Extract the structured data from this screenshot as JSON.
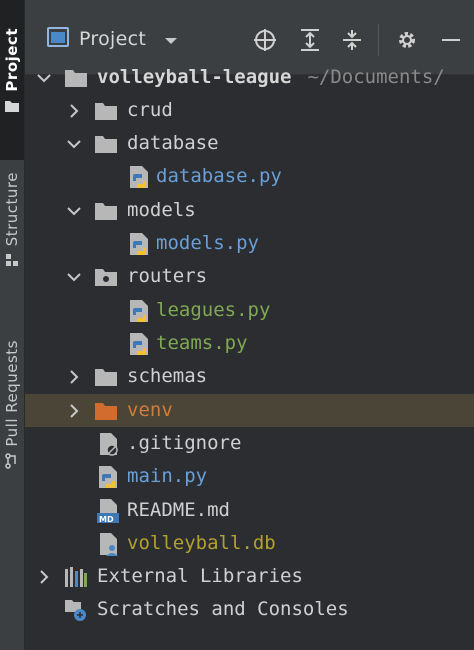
{
  "sidebar": {
    "tabs": [
      {
        "label": "Project",
        "active": true
      },
      {
        "label": "Structure",
        "active": false
      },
      {
        "label": "Pull Requests",
        "active": false
      }
    ]
  },
  "header": {
    "view_label": "Project",
    "buttons": [
      "locate-icon",
      "expand-all-icon",
      "collapse-all-icon",
      "gear-icon",
      "minimize-icon"
    ]
  },
  "tree": {
    "root": {
      "name": "volleyball-league",
      "path": "~/Documents/"
    },
    "items": [
      {
        "name": "crud",
        "type": "folder",
        "expanded": false
      },
      {
        "name": "database",
        "type": "folder",
        "expanded": true
      },
      {
        "name": "database.py",
        "type": "python"
      },
      {
        "name": "models",
        "type": "folder",
        "expanded": true
      },
      {
        "name": "models.py",
        "type": "python"
      },
      {
        "name": "routers",
        "type": "folder",
        "expanded": true
      },
      {
        "name": "leagues.py",
        "type": "python"
      },
      {
        "name": "teams.py",
        "type": "python"
      },
      {
        "name": "schemas",
        "type": "folder",
        "expanded": false
      },
      {
        "name": "venv",
        "type": "excluded-folder",
        "expanded": false,
        "selected": true
      },
      {
        "name": ".gitignore",
        "type": "ignore-file"
      },
      {
        "name": "main.py",
        "type": "python"
      },
      {
        "name": "README.md",
        "type": "markdown"
      },
      {
        "name": "volleyball.db",
        "type": "database"
      }
    ],
    "external_libraries": "External Libraries",
    "scratches": "Scratches and Consoles"
  },
  "colors": {
    "background": "#2b2d30",
    "selection": "#4a4536",
    "modified_blue": "#6a9fd8",
    "added_green": "#7fa953",
    "excluded_orange": "#d07d3e",
    "untracked_olive": "#b3a12f"
  }
}
